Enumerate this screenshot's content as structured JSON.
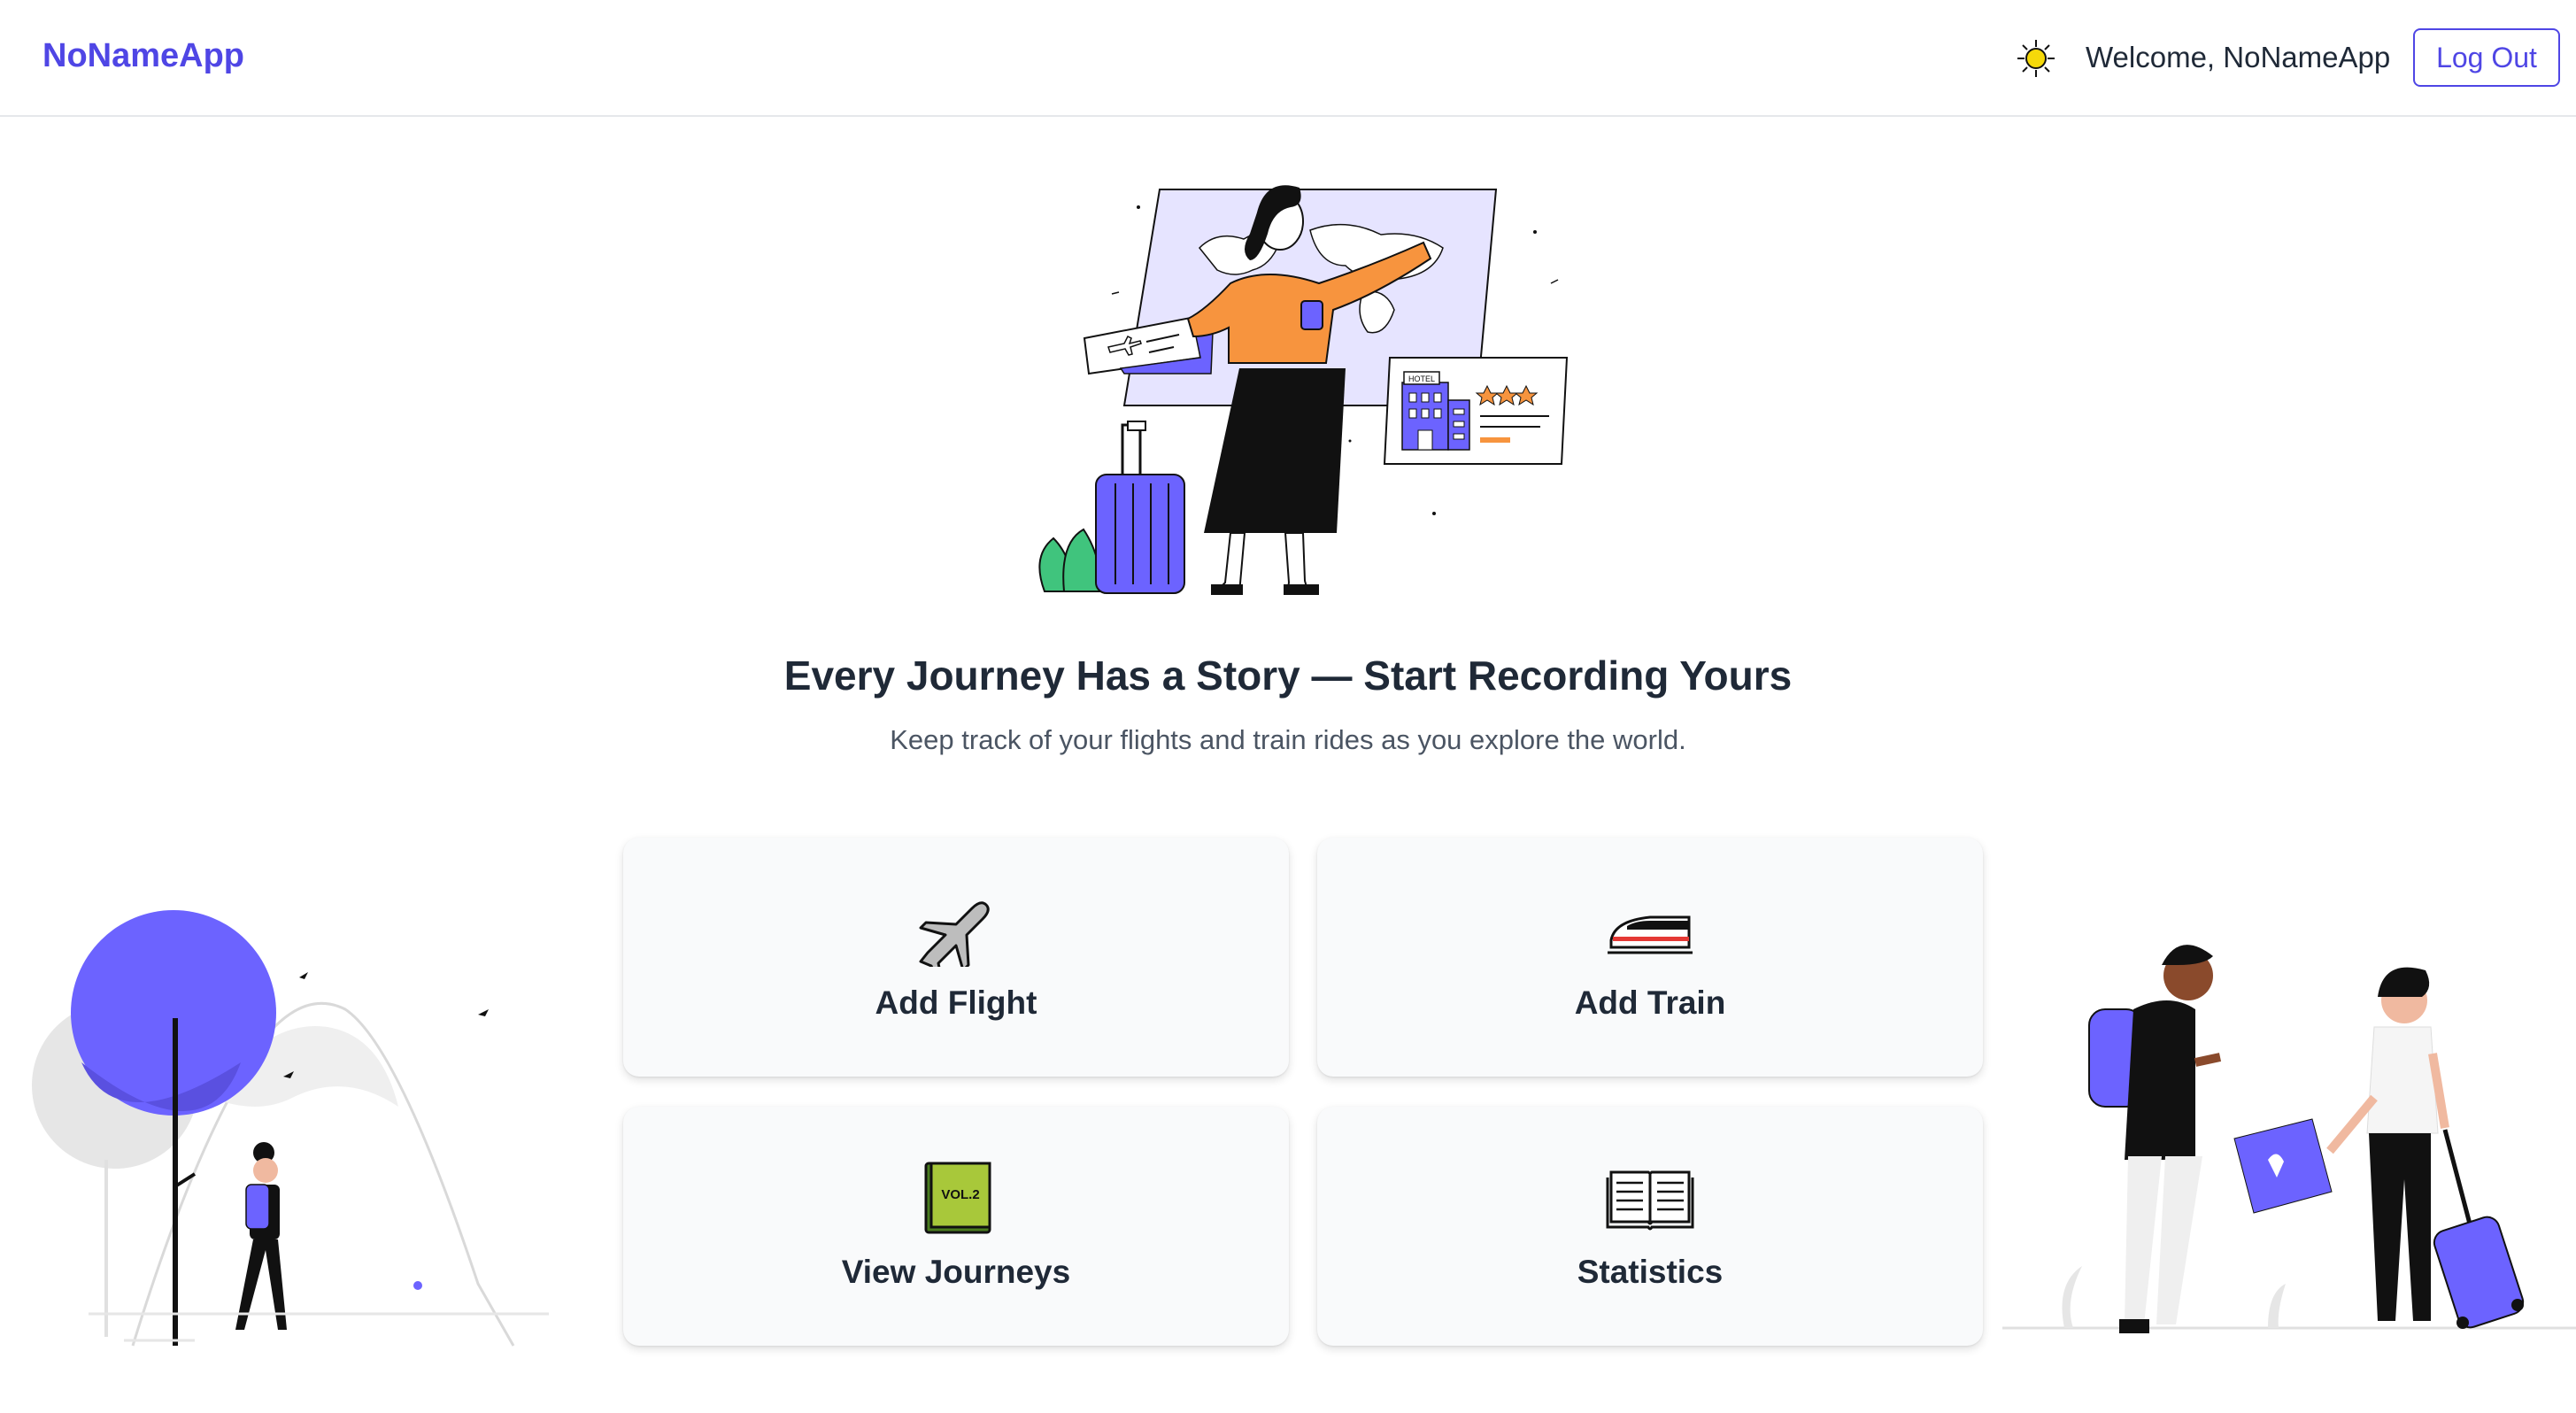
{
  "brand": "NoNameApp",
  "header": {
    "welcome": "Welcome, NoNameApp",
    "logout_label": "Log Out",
    "theme_icon": "sun-icon"
  },
  "hero": {
    "headline": "Every Journey Has a Story — Start Recording Yours",
    "subline": "Keep track of your flights and train rides as you explore the world.",
    "hotel_sign": "HOTEL"
  },
  "cards": [
    {
      "label": "Add Flight",
      "icon": "airplane-icon"
    },
    {
      "label": "Add Train",
      "icon": "train-icon"
    },
    {
      "label": "View Journeys",
      "icon": "book-icon",
      "icon_text": "VOL.2"
    },
    {
      "label": "Statistics",
      "icon": "open-book-icon"
    }
  ],
  "colors": {
    "accent": "#4f46e5",
    "illustration_purple": "#6c63ff",
    "orange": "#f7943e",
    "card_bg": "#f9fafb",
    "text": "#1f2937",
    "muted": "#4b5563"
  }
}
